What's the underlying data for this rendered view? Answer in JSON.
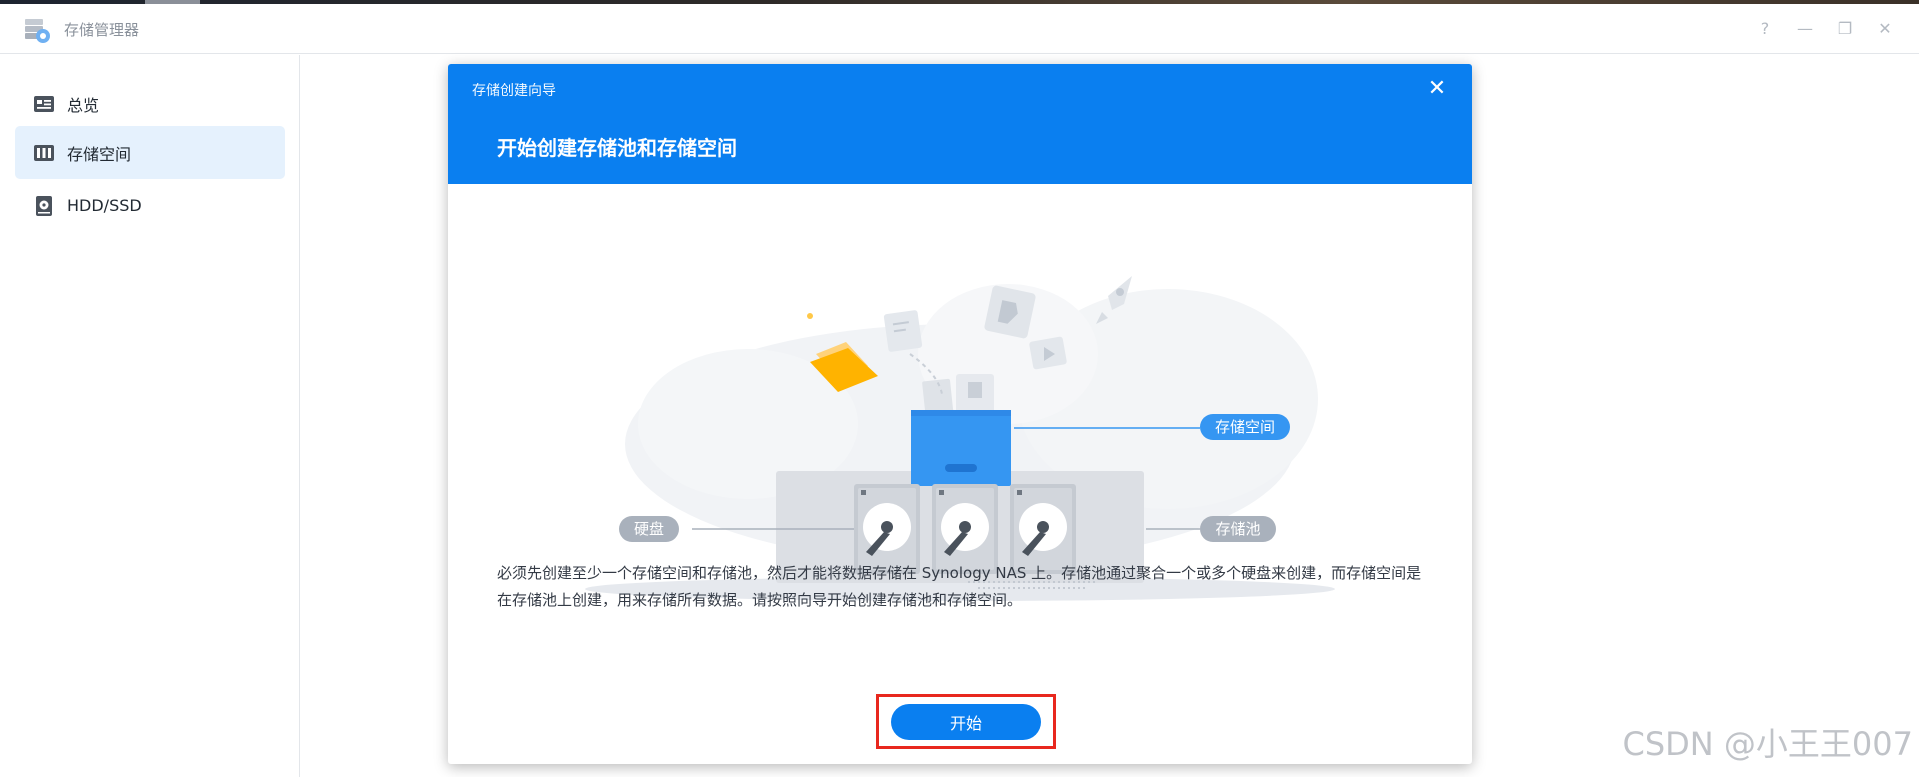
{
  "window": {
    "title": "存储管理器",
    "controls": [
      "?",
      "—",
      "❐",
      "✕"
    ]
  },
  "sidebar": {
    "items": [
      {
        "label": "总览",
        "icon": "dashboard-icon",
        "active": false
      },
      {
        "label": "存储空间",
        "icon": "storage-space-icon",
        "active": true
      },
      {
        "label": "HDD/SSD",
        "icon": "disk-icon",
        "active": false
      }
    ]
  },
  "wizard": {
    "title": "存储创建向导",
    "heading": "开始创建存储池和存储空间",
    "illustration_labels": {
      "volume": "存储空间",
      "drive": "硬盘",
      "pool": "存储池"
    },
    "description": "必须先创建至少一个存储空间和存储池，然后才能将数据存储在 Synology NAS 上。存储池通过聚合一个或多个硬盘来创建，而存储空间是在存储池上创建，用来存储所有数据。请按照向导开始创建存储池和存储空间。",
    "start_label": "开始"
  },
  "watermark": "CSDN @小王王007",
  "colors": {
    "accent": "#0a7ff0",
    "highlight": "#e8281e",
    "sidebar_active": "#e5f1fd"
  }
}
